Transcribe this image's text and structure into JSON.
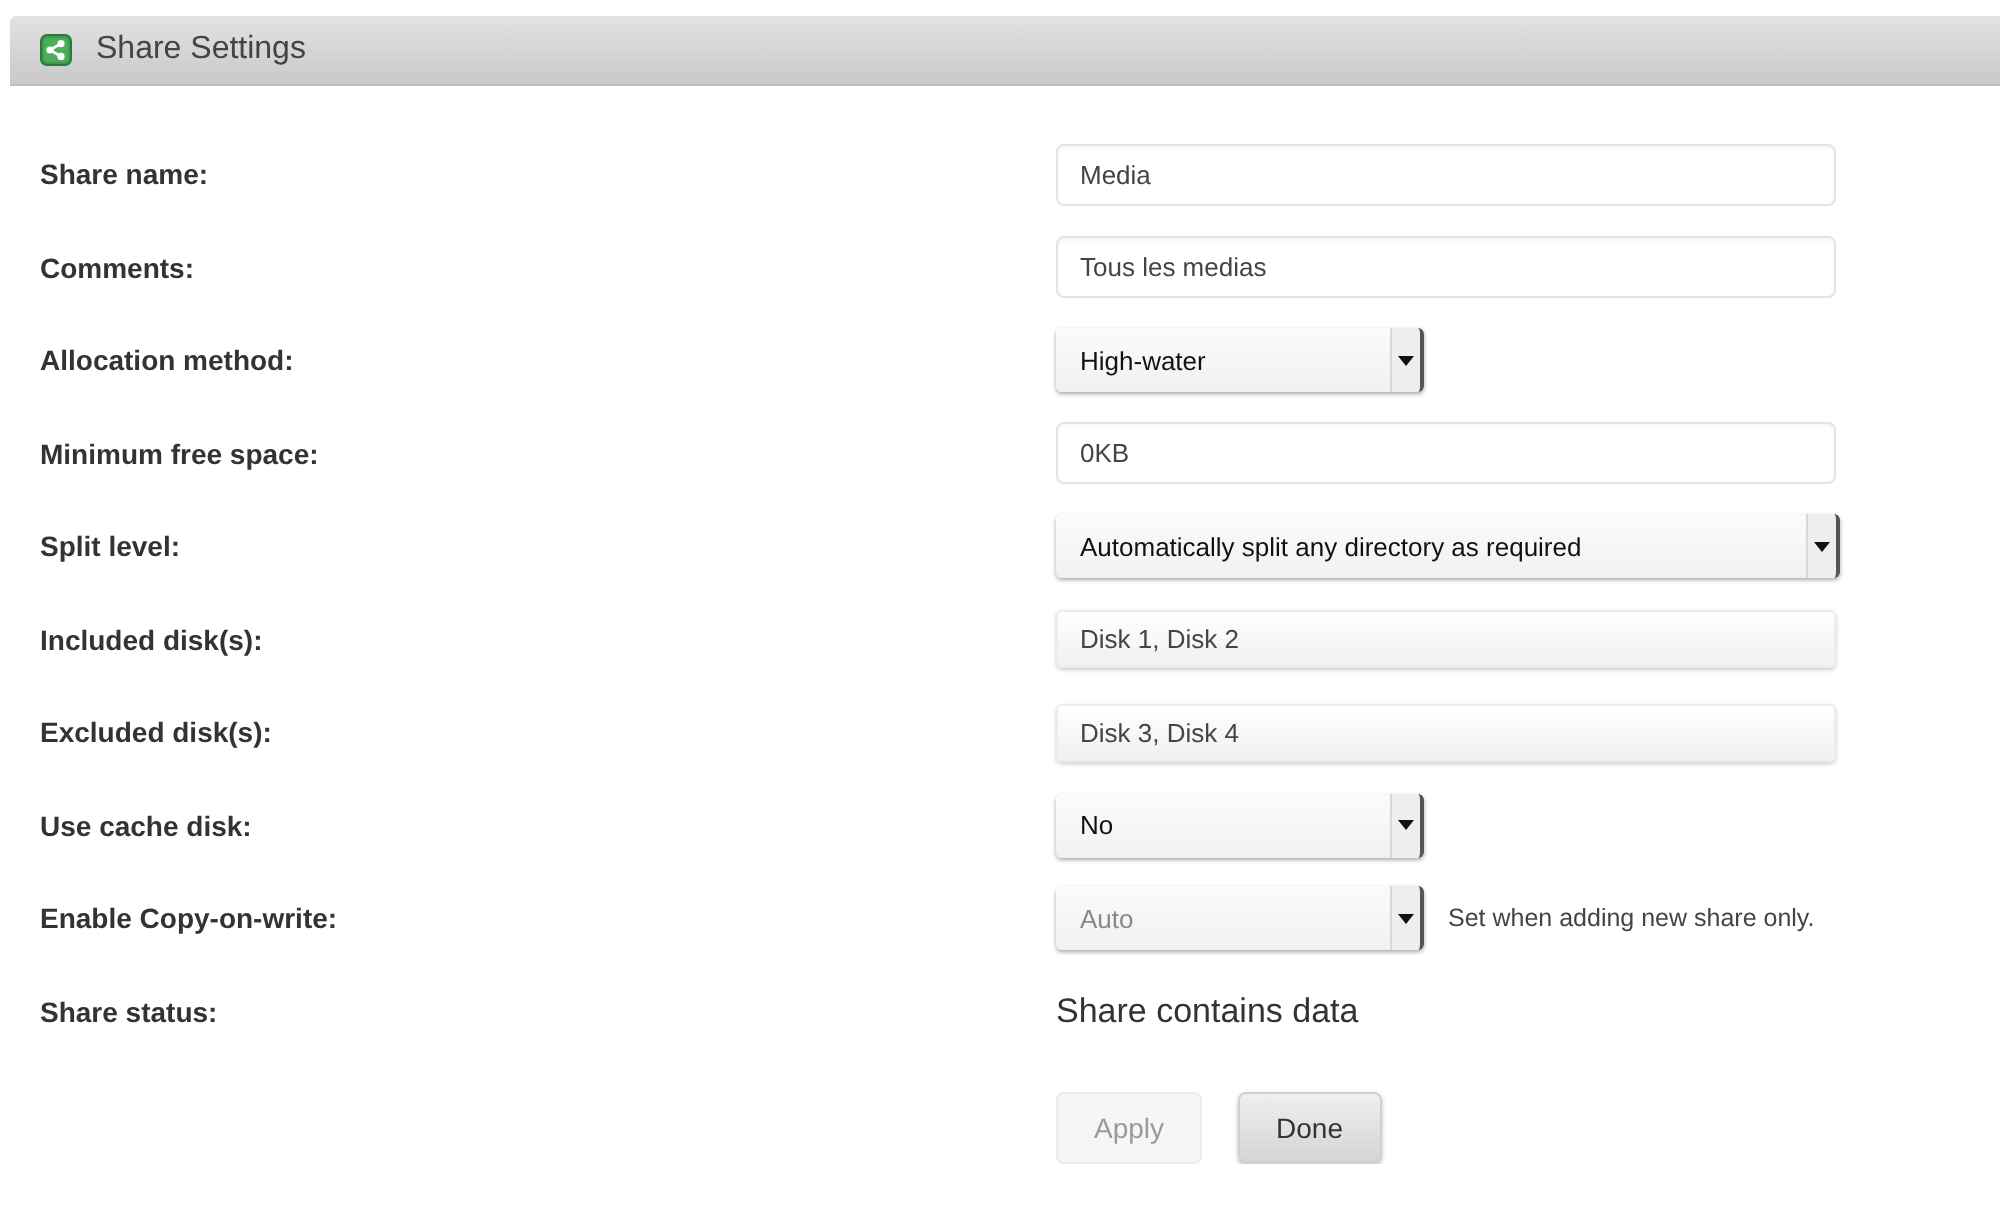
{
  "window": {
    "title": "Share Settings"
  },
  "fields": [
    {
      "label": "Share name:",
      "kind": "text",
      "value": "Media",
      "disabled": false
    },
    {
      "label": "Comments:",
      "kind": "text",
      "value": "Tous les medias",
      "disabled": false
    },
    {
      "label": "Allocation method:",
      "kind": "select",
      "value": "High-water",
      "disabled": false
    },
    {
      "label": "Minimum free space:",
      "kind": "text",
      "value": "0KB",
      "disabled": false
    },
    {
      "label": "Split level:",
      "kind": "select",
      "value": "Automatically split any directory as required",
      "disabled": false
    },
    {
      "label": "Included disk(s):",
      "kind": "checklist",
      "value": "Disk 1, Disk 2",
      "disabled": false
    },
    {
      "label": "Excluded disk(s):",
      "kind": "checklist",
      "value": "Disk 3, Disk 4",
      "disabled": false
    },
    {
      "label": "Use cache disk:",
      "kind": "select",
      "value": "No",
      "disabled": false
    },
    {
      "label": "Enable Copy-on-write:",
      "kind": "select",
      "value": "Auto",
      "disabled": true,
      "note": "Set when adding new share only."
    },
    {
      "label": "Share status:",
      "kind": "status",
      "value": "Share contains data",
      "disabled": false
    }
  ],
  "buttons": [
    {
      "label": "Apply",
      "disabled": true
    },
    {
      "label": "Done",
      "disabled": false
    }
  ]
}
